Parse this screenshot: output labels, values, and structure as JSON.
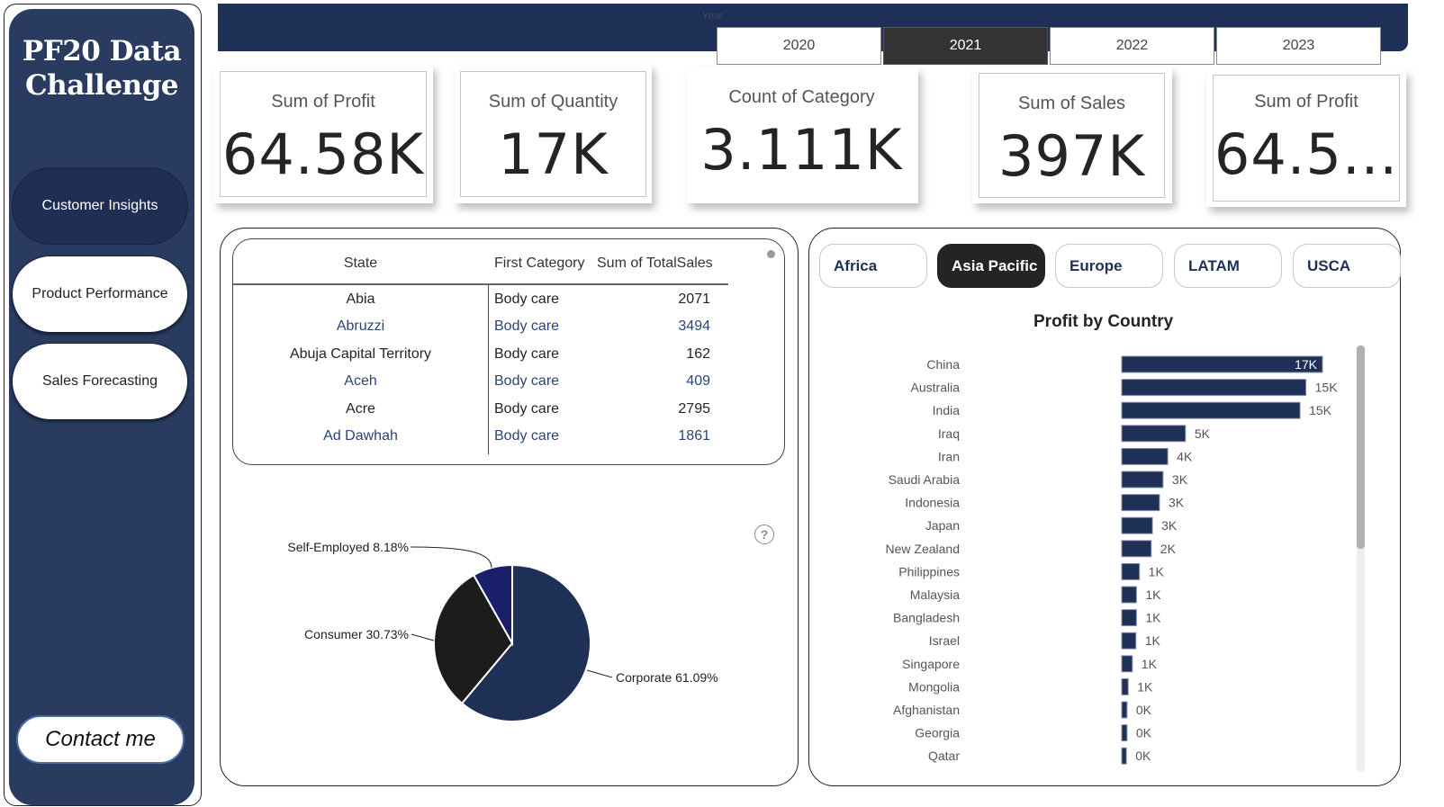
{
  "sidebar": {
    "title_line1": "PF20 Data",
    "title_line2": "Challenge",
    "nav": [
      {
        "label": "Customer Insights",
        "active": true
      },
      {
        "label": "Product Performance",
        "active": false
      },
      {
        "label": "Sales Forecasting",
        "active": false
      }
    ],
    "contact_label": "Contact me"
  },
  "year_slicer": {
    "label": "Year",
    "options": [
      "2020",
      "2021",
      "2022",
      "2023"
    ],
    "selected": "2021"
  },
  "kpis": [
    {
      "label": "Sum of Profit",
      "value": "64.58K"
    },
    {
      "label": "Sum of Quantity",
      "value": "17K"
    },
    {
      "label": "Count of Category",
      "value": "3.111K"
    },
    {
      "label": "Sum of Sales",
      "value": "397K"
    },
    {
      "label": "Sum of Profit",
      "value": "64.5..."
    }
  ],
  "table": {
    "columns": [
      "State",
      "First Category",
      "Sum of TotalSales"
    ],
    "rows": [
      {
        "state": "Abia",
        "category": "Body care",
        "sales": "2071"
      },
      {
        "state": "Abruzzi",
        "category": "Body care",
        "sales": "3494"
      },
      {
        "state": "Abuja Capital Territory",
        "category": "Body care",
        "sales": "162"
      },
      {
        "state": "Aceh",
        "category": "Body care",
        "sales": "409"
      },
      {
        "state": "Acre",
        "category": "Body care",
        "sales": "2795"
      },
      {
        "state": "Ad Dawhah",
        "category": "Body care",
        "sales": "1861"
      }
    ]
  },
  "help_icon": "?",
  "region_slicer": {
    "options": [
      "Africa",
      "Asia Pacific",
      "Europe",
      "LATAM",
      "USCA"
    ],
    "selected": "Asia Pacific"
  },
  "colors": {
    "navy": "#1f3056",
    "dark": "#252423",
    "pie_corporate": "#1f3056",
    "pie_consumer": "#1c1c1c",
    "pie_selfemployed": "#1a1f6b"
  },
  "chart_data": [
    {
      "type": "pie",
      "title": "",
      "categories": [
        "Corporate",
        "Consumer",
        "Self-Employed"
      ],
      "values": [
        61.09,
        30.73,
        8.18
      ],
      "labels": [
        "Corporate 61.09%",
        "Consumer 30.73%",
        "Self-Employed 8.18%"
      ],
      "unit": "%"
    },
    {
      "type": "bar",
      "orientation": "horizontal",
      "title": "Profit by Country",
      "categories": [
        "China",
        "Australia",
        "India",
        "Iraq",
        "Iran",
        "Saudi Arabia",
        "Indonesia",
        "Japan",
        "New Zealand",
        "Philippines",
        "Malaysia",
        "Bangladesh",
        "Israel",
        "Singapore",
        "Mongolia",
        "Afghanistan",
        "Georgia",
        "Qatar"
      ],
      "values": [
        17000,
        15600,
        15100,
        5400,
        3900,
        3500,
        3200,
        2600,
        2500,
        1500,
        1250,
        1250,
        1200,
        900,
        550,
        450,
        450,
        400
      ],
      "data_labels": [
        "17K",
        "15K",
        "15K",
        "5K",
        "4K",
        "3K",
        "3K",
        "3K",
        "2K",
        "1K",
        "1K",
        "1K",
        "1K",
        "1K",
        "1K",
        "0K",
        "0K",
        "0K"
      ],
      "xlabel": "",
      "ylabel": "",
      "xlim": [
        0,
        17000
      ],
      "grid": false
    }
  ]
}
